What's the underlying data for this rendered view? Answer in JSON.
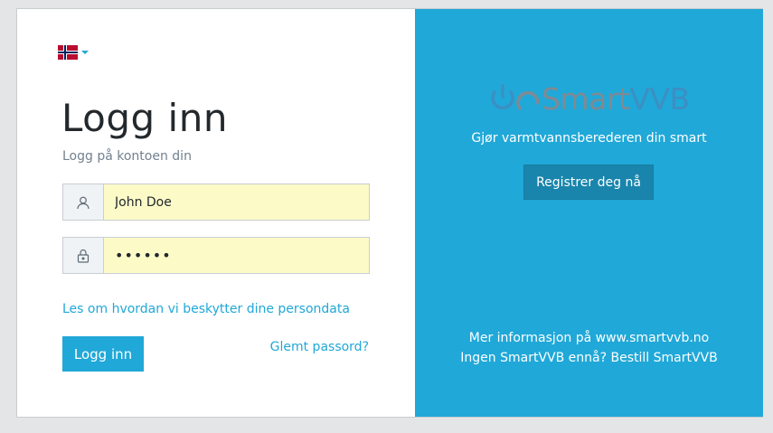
{
  "language": {
    "flag": "norway-flag-icon",
    "caret": "caret-down-icon"
  },
  "login": {
    "title": "Logg inn",
    "subtitle": "Logg på kontoen din",
    "username_value": "John Doe",
    "password_value": "••••••",
    "user_icon": "user-icon",
    "lock_icon": "lock-icon",
    "privacy_link": "Les om hvordan vi beskytter dine persondata",
    "login_button": "Logg inn",
    "forgot_link": "Glemt passord?"
  },
  "promo": {
    "logo_smart": "Smart",
    "logo_vvb": "VVB",
    "tagline": "Gjør varmtvannsberederen din smart",
    "register_button": "Registrer deg nå",
    "info_line1": "Mer informasjon på www.smartvvb.no",
    "info_line2": "Ingen SmartVVB ennå? Bestill SmartVVB"
  },
  "colors": {
    "accent": "#20a8d8",
    "button_dark": "#1985ac",
    "autofill": "#fcfbc8",
    "background": "#e4e5e6"
  }
}
